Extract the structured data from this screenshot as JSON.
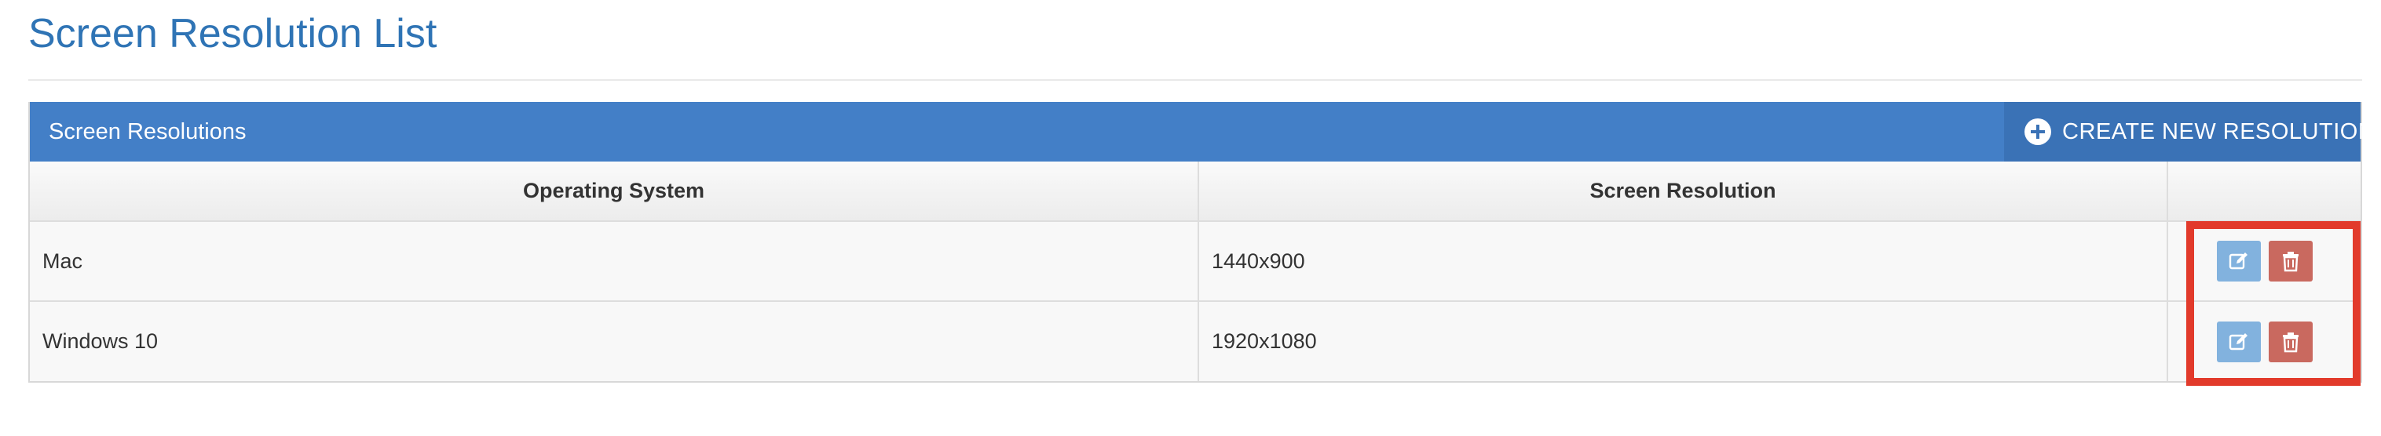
{
  "page": {
    "title": "Screen Resolution List"
  },
  "panel": {
    "title": "Screen Resolutions",
    "create_button_label": "CREATE NEW RESOLUTION"
  },
  "table": {
    "headers": [
      "Operating System",
      "Screen Resolution",
      ""
    ],
    "rows": [
      {
        "os": "Mac",
        "resolution": "1440x900"
      },
      {
        "os": "Windows 10",
        "resolution": "1920x1080"
      }
    ]
  },
  "icons": {
    "create": "plus-circle-icon",
    "edit": "edit-icon",
    "delete": "trash-icon"
  },
  "colors": {
    "title": "#2f74b5",
    "panel_header": "#437fc7",
    "create_button": "#3a72b6",
    "edit_button": "#82b2de",
    "delete_button": "#c9695f",
    "highlight": "#e23a2b"
  }
}
